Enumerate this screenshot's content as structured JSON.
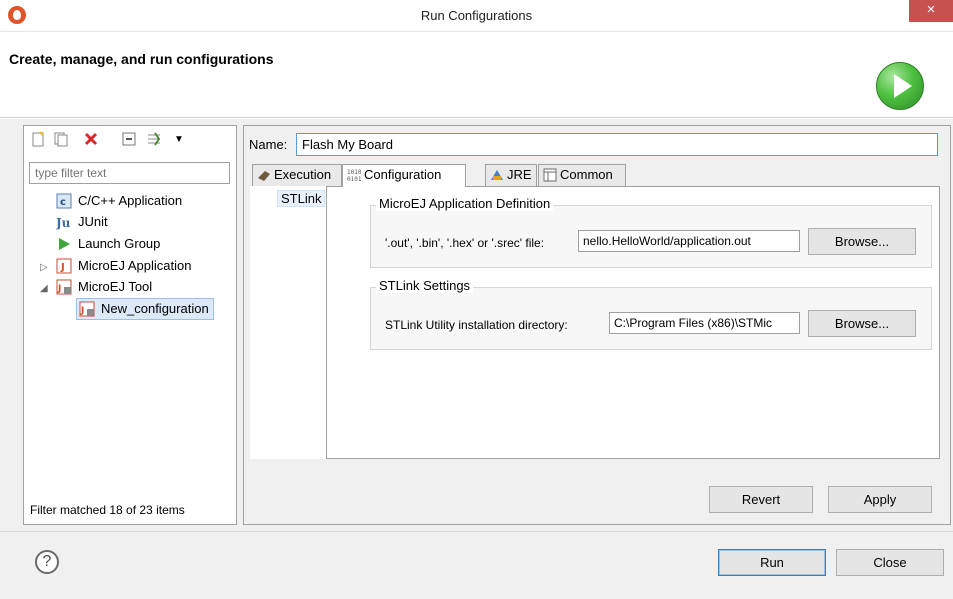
{
  "window": {
    "title": "Run Configurations",
    "close_glyph": "×"
  },
  "header": {
    "text": "Create, manage, and run configurations"
  },
  "toolbar": {
    "icons": [
      "new-config-icon",
      "duplicate-icon",
      "delete-icon",
      "collapse-all-icon",
      "filter-icon",
      "view-menu-chevron-icon"
    ]
  },
  "left": {
    "filter_placeholder": "type filter text",
    "tree": [
      {
        "label": "C/C++ Application",
        "icon": "cpp-app-icon"
      },
      {
        "label": "JUnit",
        "icon": "junit-icon"
      },
      {
        "label": "Launch Group",
        "icon": "launch-group-icon"
      },
      {
        "label": "MicroEJ Application",
        "icon": "microej-app-icon",
        "expanded": false
      },
      {
        "label": "MicroEJ Tool",
        "icon": "microej-tool-icon",
        "expanded": true
      },
      {
        "label": "New_configuration",
        "icon": "microej-tool-icon",
        "selected": true
      }
    ],
    "status": "Filter matched 18 of 23 items"
  },
  "right": {
    "name_label": "Name:",
    "name_value": "Flash My Board",
    "tabs": [
      {
        "label": "Execution",
        "icon": "execution-icon"
      },
      {
        "label": "Configuration",
        "icon": "binary-icon",
        "active": true
      },
      {
        "label": "JRE",
        "icon": "jre-icon"
      },
      {
        "label": "Common",
        "icon": "common-icon"
      }
    ],
    "side_list": [
      "STLink"
    ],
    "group1": {
      "title": "MicroEJ Application Definition",
      "label": "'.out', '.bin', '.hex' or '.srec' file:",
      "value": "nello.HelloWorld/application.out",
      "browse": "Browse..."
    },
    "group2": {
      "title": "STLink Settings",
      "label": "STLink Utility installation directory:",
      "value": "C:\\Program Files (x86)\\STMic",
      "browse": "Browse..."
    },
    "revert": "Revert",
    "apply": "Apply"
  },
  "footer": {
    "help_glyph": "?",
    "run": "Run",
    "close": "Close"
  },
  "colors": {
    "accent": "#5b9bd5",
    "close_bg": "#c75050",
    "run_green": "#4ec041"
  }
}
